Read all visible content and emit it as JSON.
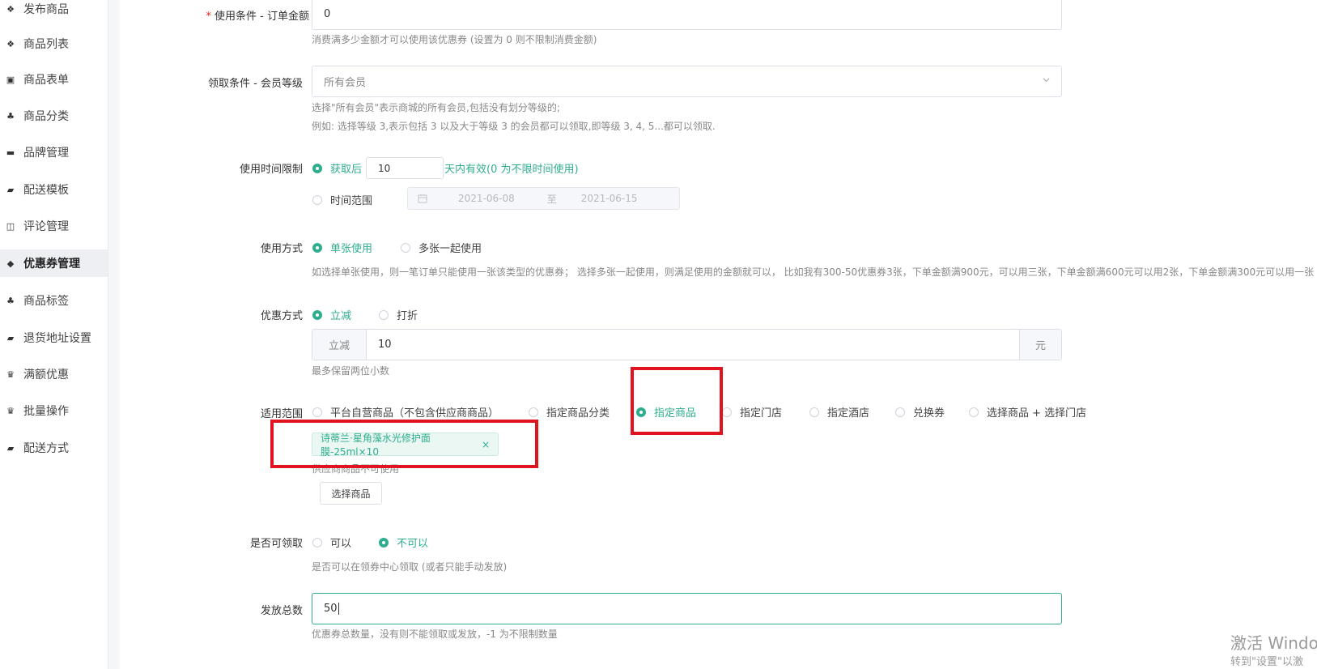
{
  "sidebar": {
    "items": [
      {
        "label": "发布商品",
        "icon": "cubes-icon",
        "glyph": "❖"
      },
      {
        "label": "商品列表",
        "icon": "cubes-icon",
        "glyph": "❖"
      },
      {
        "label": "商品表单",
        "icon": "excel-file-icon",
        "glyph": "▣"
      },
      {
        "label": "商品分类",
        "icon": "sitemap-icon",
        "glyph": "♣"
      },
      {
        "label": "品牌管理",
        "icon": "briefcase-icon",
        "glyph": "▬"
      },
      {
        "label": "配送模板",
        "icon": "truck-icon",
        "glyph": "▰"
      },
      {
        "label": "评论管理",
        "icon": "columns-icon",
        "glyph": "◫"
      },
      {
        "label": "优惠券管理",
        "icon": "tags-icon",
        "glyph": "◆"
      },
      {
        "label": "商品标签",
        "icon": "sitemap-icon",
        "glyph": "♣"
      },
      {
        "label": "退货地址设置",
        "icon": "truck-icon",
        "glyph": "▰"
      },
      {
        "label": "满额优惠",
        "icon": "gift-icon",
        "glyph": "♛"
      },
      {
        "label": "批量操作",
        "icon": "gift-icon",
        "glyph": "♛"
      },
      {
        "label": "配送方式",
        "icon": "truck-icon",
        "glyph": "▰"
      }
    ],
    "active_index": 7
  },
  "form": {
    "order_amount": {
      "required_mark": "*",
      "label": "使用条件 - 订单金额",
      "value": "0",
      "hint": "消费满多少金额才可以使用该优惠券 (设置为 0 则不限制消费金额)"
    },
    "member_level": {
      "label": "领取条件 - 会员等级",
      "selected": "所有会员",
      "hint1": "选择\"所有会员\"表示商城的所有会员,包括没有划分等级的;",
      "hint2": "例如: 选择等级 3,表示包括 3 以及大于等级 3 的会员都可以领取,即等级 3, 4, 5...都可以领取."
    },
    "time_limit": {
      "label": "使用时间限制",
      "option_days_prefix": "获取后",
      "days_value": "10",
      "option_days_suffix": "天内有效(0 为不限时间使用)",
      "option_range": "时间范围",
      "range_start": "2021-06-08",
      "range_sep": "至",
      "range_end": "2021-06-15"
    },
    "usage": {
      "label": "使用方式",
      "option_single": "单张使用",
      "option_multi": "多张一起使用",
      "hint": "如选择单张使用，则一笔订单只能使用一张该类型的优惠券； 选择多张一起使用，则满足使用的金额就可以， 比如我有300-50优惠券3张，下单金额满900元，可以用三张，下单金额满600元可以用2张，下单金额满300元可以用一张"
    },
    "discount": {
      "label": "优惠方式",
      "option_reduce": "立减",
      "option_percent": "打折",
      "prefix": "立减",
      "value": "10",
      "suffix": "元",
      "hint": "最多保留两位小数"
    },
    "scope": {
      "label": "适用范围",
      "options": [
        "平台自营商品（不包含供应商商品）",
        "指定商品分类",
        "指定商品",
        "指定门店",
        "指定酒店",
        "兑换券",
        "选择商品 + 选择门店"
      ],
      "selected_index": 2,
      "tag": "诗蒂兰·星角藻水光修护面膜-25ml×10",
      "tag_close": "×",
      "hint": "供应商商品不可使用",
      "select_button": "选择商品"
    },
    "claimable": {
      "label": "是否可领取",
      "option_yes": "可以",
      "option_no": "不可以",
      "hint": "是否可以在领券中心领取 (或者只能手动发放)"
    },
    "total": {
      "label": "发放总数",
      "value": "50",
      "hint": "优惠券总数量，没有则不能领取或发放，-1 为不限制数量"
    }
  },
  "watermark": {
    "line1": "激活 Windo",
    "line2": "转到\"设置\"以激"
  },
  "colors": {
    "accent": "#2fae8f",
    "highlight_box": "#e0141e"
  }
}
